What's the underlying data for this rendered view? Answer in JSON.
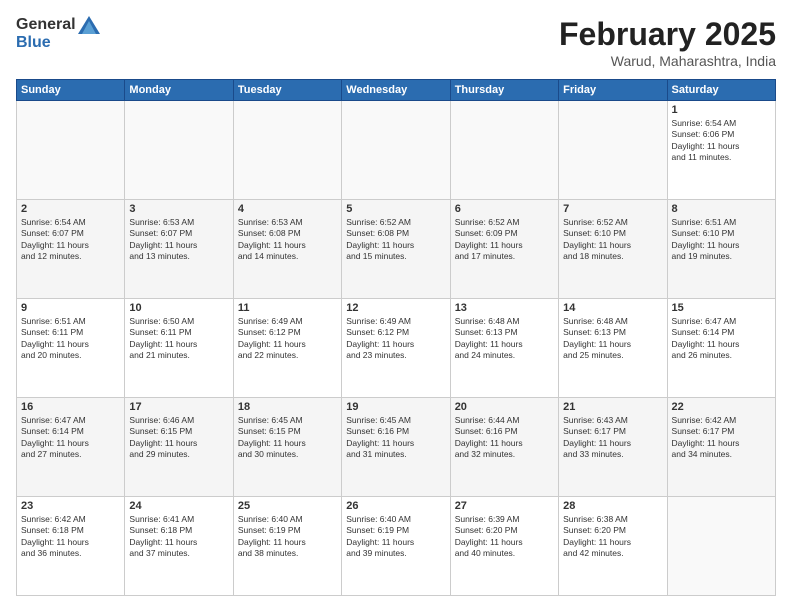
{
  "header": {
    "logo_line1": "General",
    "logo_line2": "Blue",
    "month_title": "February 2025",
    "location": "Warud, Maharashtra, India"
  },
  "weekdays": [
    "Sunday",
    "Monday",
    "Tuesday",
    "Wednesday",
    "Thursday",
    "Friday",
    "Saturday"
  ],
  "weeks": [
    [
      {
        "day": "",
        "info": ""
      },
      {
        "day": "",
        "info": ""
      },
      {
        "day": "",
        "info": ""
      },
      {
        "day": "",
        "info": ""
      },
      {
        "day": "",
        "info": ""
      },
      {
        "day": "",
        "info": ""
      },
      {
        "day": "1",
        "info": "Sunrise: 6:54 AM\nSunset: 6:06 PM\nDaylight: 11 hours\nand 11 minutes."
      }
    ],
    [
      {
        "day": "2",
        "info": "Sunrise: 6:54 AM\nSunset: 6:07 PM\nDaylight: 11 hours\nand 12 minutes."
      },
      {
        "day": "3",
        "info": "Sunrise: 6:53 AM\nSunset: 6:07 PM\nDaylight: 11 hours\nand 13 minutes."
      },
      {
        "day": "4",
        "info": "Sunrise: 6:53 AM\nSunset: 6:08 PM\nDaylight: 11 hours\nand 14 minutes."
      },
      {
        "day": "5",
        "info": "Sunrise: 6:52 AM\nSunset: 6:08 PM\nDaylight: 11 hours\nand 15 minutes."
      },
      {
        "day": "6",
        "info": "Sunrise: 6:52 AM\nSunset: 6:09 PM\nDaylight: 11 hours\nand 17 minutes."
      },
      {
        "day": "7",
        "info": "Sunrise: 6:52 AM\nSunset: 6:10 PM\nDaylight: 11 hours\nand 18 minutes."
      },
      {
        "day": "8",
        "info": "Sunrise: 6:51 AM\nSunset: 6:10 PM\nDaylight: 11 hours\nand 19 minutes."
      }
    ],
    [
      {
        "day": "9",
        "info": "Sunrise: 6:51 AM\nSunset: 6:11 PM\nDaylight: 11 hours\nand 20 minutes."
      },
      {
        "day": "10",
        "info": "Sunrise: 6:50 AM\nSunset: 6:11 PM\nDaylight: 11 hours\nand 21 minutes."
      },
      {
        "day": "11",
        "info": "Sunrise: 6:49 AM\nSunset: 6:12 PM\nDaylight: 11 hours\nand 22 minutes."
      },
      {
        "day": "12",
        "info": "Sunrise: 6:49 AM\nSunset: 6:12 PM\nDaylight: 11 hours\nand 23 minutes."
      },
      {
        "day": "13",
        "info": "Sunrise: 6:48 AM\nSunset: 6:13 PM\nDaylight: 11 hours\nand 24 minutes."
      },
      {
        "day": "14",
        "info": "Sunrise: 6:48 AM\nSunset: 6:13 PM\nDaylight: 11 hours\nand 25 minutes."
      },
      {
        "day": "15",
        "info": "Sunrise: 6:47 AM\nSunset: 6:14 PM\nDaylight: 11 hours\nand 26 minutes."
      }
    ],
    [
      {
        "day": "16",
        "info": "Sunrise: 6:47 AM\nSunset: 6:14 PM\nDaylight: 11 hours\nand 27 minutes."
      },
      {
        "day": "17",
        "info": "Sunrise: 6:46 AM\nSunset: 6:15 PM\nDaylight: 11 hours\nand 29 minutes."
      },
      {
        "day": "18",
        "info": "Sunrise: 6:45 AM\nSunset: 6:15 PM\nDaylight: 11 hours\nand 30 minutes."
      },
      {
        "day": "19",
        "info": "Sunrise: 6:45 AM\nSunset: 6:16 PM\nDaylight: 11 hours\nand 31 minutes."
      },
      {
        "day": "20",
        "info": "Sunrise: 6:44 AM\nSunset: 6:16 PM\nDaylight: 11 hours\nand 32 minutes."
      },
      {
        "day": "21",
        "info": "Sunrise: 6:43 AM\nSunset: 6:17 PM\nDaylight: 11 hours\nand 33 minutes."
      },
      {
        "day": "22",
        "info": "Sunrise: 6:42 AM\nSunset: 6:17 PM\nDaylight: 11 hours\nand 34 minutes."
      }
    ],
    [
      {
        "day": "23",
        "info": "Sunrise: 6:42 AM\nSunset: 6:18 PM\nDaylight: 11 hours\nand 36 minutes."
      },
      {
        "day": "24",
        "info": "Sunrise: 6:41 AM\nSunset: 6:18 PM\nDaylight: 11 hours\nand 37 minutes."
      },
      {
        "day": "25",
        "info": "Sunrise: 6:40 AM\nSunset: 6:19 PM\nDaylight: 11 hours\nand 38 minutes."
      },
      {
        "day": "26",
        "info": "Sunrise: 6:40 AM\nSunset: 6:19 PM\nDaylight: 11 hours\nand 39 minutes."
      },
      {
        "day": "27",
        "info": "Sunrise: 6:39 AM\nSunset: 6:20 PM\nDaylight: 11 hours\nand 40 minutes."
      },
      {
        "day": "28",
        "info": "Sunrise: 6:38 AM\nSunset: 6:20 PM\nDaylight: 11 hours\nand 42 minutes."
      },
      {
        "day": "",
        "info": ""
      }
    ]
  ]
}
